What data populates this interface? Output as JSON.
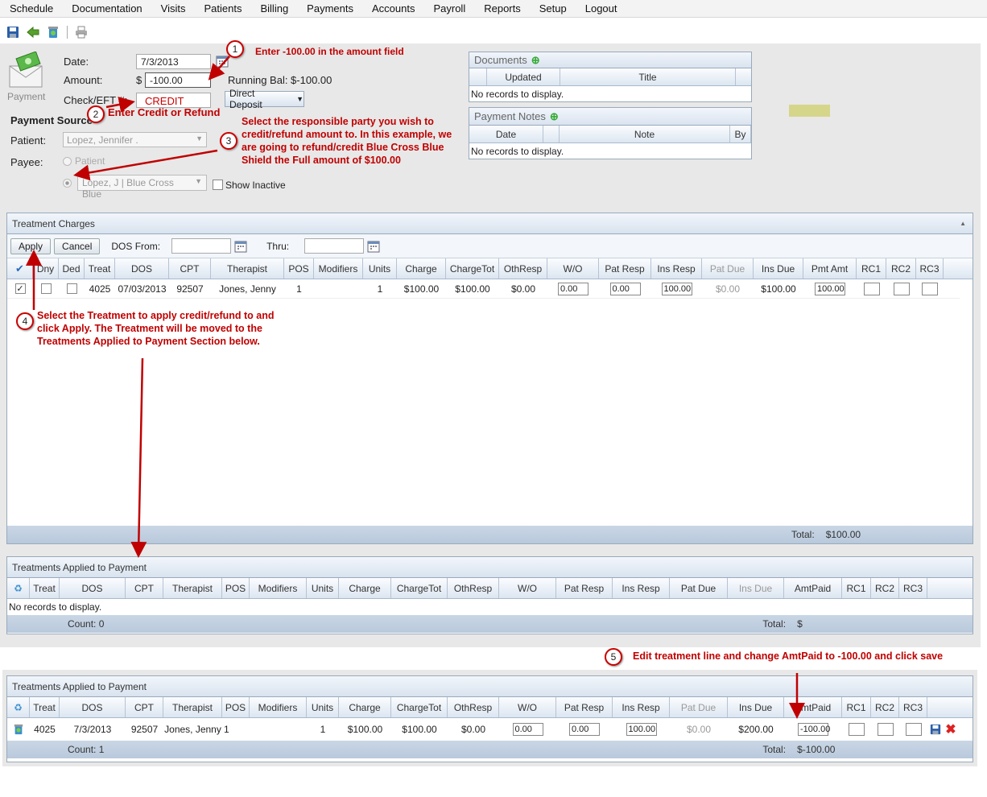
{
  "menu": [
    "Schedule",
    "Documentation",
    "Visits",
    "Patients",
    "Billing",
    "Payments",
    "Accounts",
    "Payroll",
    "Reports",
    "Setup",
    "Logout"
  ],
  "payment": {
    "icon_label": "Payment",
    "date_label": "Date:",
    "date": "7/3/2013",
    "amount_label": "Amount:",
    "currency": "$",
    "amount": "-100.00",
    "running_bal": "Running Bal: $-100.00",
    "check_label": "Check/EFT #:",
    "check": "CREDIT",
    "method": "Direct Deposit",
    "source_label": "Payment Source",
    "patient_label": "Patient:",
    "patient": "Lopez, Jennifer  .",
    "payee_label": "Payee:",
    "payee_patient": "Patient",
    "payee_insurer": "Lopez, J | Blue Cross Blue",
    "show_inactive": "Show Inactive"
  },
  "documents": {
    "title": "Documents",
    "cols": [
      "Updated",
      "Title"
    ],
    "empty": "No records to display."
  },
  "notes": {
    "title": "Payment Notes",
    "cols": [
      "Date",
      "Note",
      "By"
    ],
    "empty": "No records to display."
  },
  "annotations": {
    "n1": "1",
    "t1": "Enter -100.00 in the amount field",
    "n2": "2",
    "t2": "Enter Credit or Refund",
    "n3": "3",
    "t3a": "Select the responsible party you wish to",
    "t3b": "credit/refund amount to.  In this example, we",
    "t3c": "are going to refund/credit Blue Cross Blue",
    "t3d": "Shield the Full amount of $100.00",
    "n4": "4",
    "t4a": "Select the Treatment to apply credit/refund to and",
    "t4b": "click Apply.  The Treatment will be moved to the",
    "t4c": "Treatments Applied to Payment Section below.",
    "n5": "5",
    "t5": "Edit treatment line and change AmtPaid to -100.00 and click save"
  },
  "charges": {
    "title": "Treatment Charges",
    "apply": "Apply",
    "cancel": "Cancel",
    "dos_from": "DOS From:",
    "thru": "Thru:",
    "cols": [
      "",
      "Dny",
      "Ded",
      "Treat",
      "DOS",
      "CPT",
      "Therapist",
      "POS",
      "Modifiers",
      "Units",
      "Charge",
      "ChargeTot",
      "OthResp",
      "W/O",
      "Pat Resp",
      "Ins Resp",
      "Pat Due",
      "Ins Due",
      "Pmt Amt",
      "RC1",
      "RC2",
      "RC3"
    ],
    "row": {
      "treat": "4025",
      "dos": "07/03/2013",
      "cpt": "92507",
      "therapist": "Jones, Jenny",
      "pos": "1",
      "units": "1",
      "charge": "$100.00",
      "chargetot": "$100.00",
      "othresp": "$0.00",
      "wo": "0.00",
      "patresp": "0.00",
      "insresp": "100.00",
      "patdue": "$0.00",
      "insdue": "$100.00",
      "pmtamt": "100.00"
    },
    "total_label": "Total:",
    "total": "$100.00"
  },
  "applied1": {
    "title": "Treatments Applied to Payment",
    "cols": [
      "",
      "Treat",
      "DOS",
      "CPT",
      "Therapist",
      "POS",
      "Modifiers",
      "Units",
      "Charge",
      "ChargeTot",
      "OthResp",
      "W/O",
      "Pat Resp",
      "Ins Resp",
      "Pat Due",
      "Ins Due",
      "AmtPaid",
      "RC1",
      "RC2",
      "RC3"
    ],
    "empty": "No records to display.",
    "count": "Count: 0",
    "total_label": "Total:",
    "total": "$"
  },
  "applied2": {
    "title": "Treatments Applied to Payment",
    "cols": [
      "",
      "Treat",
      "DOS",
      "CPT",
      "Therapist",
      "POS",
      "Modifiers",
      "Units",
      "Charge",
      "ChargeTot",
      "OthResp",
      "W/O",
      "Pat Resp",
      "Ins Resp",
      "Pat Due",
      "Ins Due",
      "AmtPaid",
      "RC1",
      "RC2",
      "RC3"
    ],
    "row": {
      "treat": "4025",
      "dos": "7/3/2013",
      "cpt": "92507",
      "therapist": "Jones, Jenny",
      "pos": "1",
      "units": "1",
      "charge": "$100.00",
      "chargetot": "$100.00",
      "othresp": "$0.00",
      "wo": "0.00",
      "patresp": "0.00",
      "insresp": "100.00",
      "patdue": "$0.00",
      "insdue": "$200.00",
      "amtpaid": "-100.00"
    },
    "count": "Count: 1",
    "total_label": "Total:",
    "total": "$-100.00"
  },
  "colors": {
    "annotation": "#c00000",
    "header": "#dce6f1",
    "footer": "#c2d1e3"
  }
}
